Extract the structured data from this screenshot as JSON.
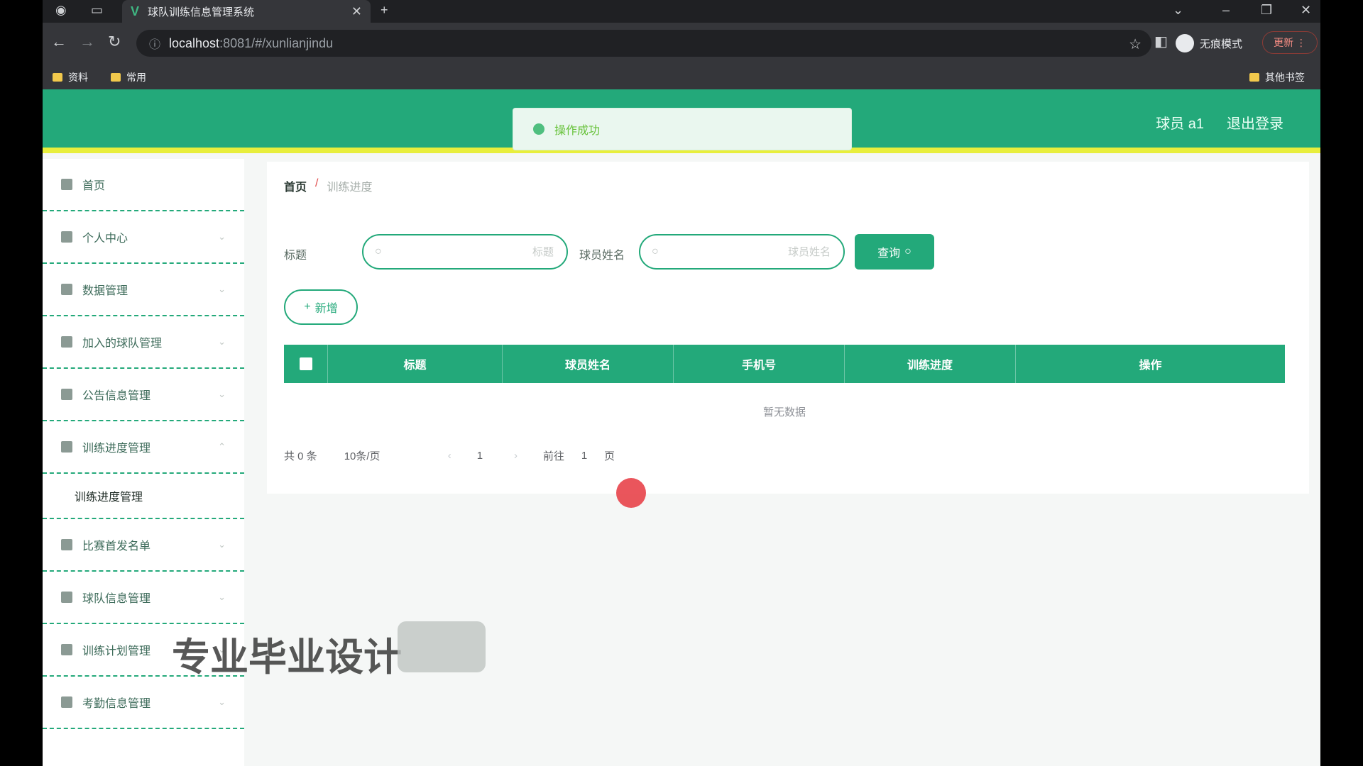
{
  "browser": {
    "tab_title": "球队训练信息管理系统",
    "url_host": "localhost",
    "url_path": ":8081/#/xunlianjindu",
    "incognito_label": "无痕模式",
    "update_label": "更新",
    "bookmarks": [
      "资料",
      "常用"
    ],
    "other_bookmarks": "其他书签"
  },
  "header": {
    "user_label": "球员 a1",
    "logout_label": "退出登录"
  },
  "toast": {
    "message": "操作成功"
  },
  "sidebar": {
    "items": [
      {
        "label": "首页"
      },
      {
        "label": "个人中心"
      },
      {
        "label": "数据管理"
      },
      {
        "label": "加入的球队管理"
      },
      {
        "label": "公告信息管理"
      },
      {
        "label": "训练进度管理"
      },
      {
        "label": "训练进度管理"
      },
      {
        "label": "比赛首发名单"
      },
      {
        "label": "球队信息管理"
      },
      {
        "label": "训练计划管理"
      },
      {
        "label": "考勤信息管理"
      }
    ]
  },
  "breadcrumb": {
    "home": "首页",
    "separator": "/",
    "current": "训练进度"
  },
  "search": {
    "title_label": "标题",
    "title_placeholder": "标题",
    "player_label": "球员姓名",
    "player_placeholder": "球员姓名",
    "query_label": "查询",
    "add_label": "新增"
  },
  "table": {
    "columns": [
      "标题",
      "球员姓名",
      "手机号",
      "训练进度",
      "操作"
    ],
    "empty_text": "暂无数据"
  },
  "pagination": {
    "total": "共 0 条",
    "page_size": "10条/页",
    "current_page": "1",
    "goto_label": "前往",
    "goto_value": "1",
    "page_unit": "页"
  },
  "watermark": "专业毕业设计",
  "colors": {
    "primary": "#23a97a",
    "header_underline": "#e8ee3c",
    "toast_bg": "#eaf7ef"
  }
}
